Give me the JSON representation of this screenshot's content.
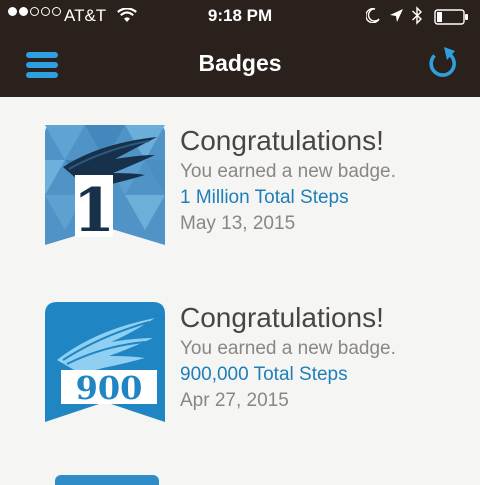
{
  "status_bar": {
    "carrier": "AT&T",
    "time": "9:18 PM",
    "signal_bars_filled": 2,
    "signal_bars_total": 5,
    "battery_level": 0.2
  },
  "nav": {
    "title": "Badges",
    "menu_icon": "hamburger-menu-icon",
    "refresh_icon": "refresh-icon"
  },
  "badges": [
    {
      "heading": "Congratulations!",
      "message": "You earned a new badge.",
      "badge_name": "1 Million Total Steps",
      "date": "May 13, 2015",
      "icon_number": "1"
    },
    {
      "heading": "Congratulations!",
      "message": "You earned a new badge.",
      "badge_name": "900,000 Total Steps",
      "date": "Apr 27, 2015",
      "icon_number": "900"
    }
  ],
  "colors": {
    "header_bg": "#2b211c",
    "accent_blue": "#2ea0e0",
    "link_blue": "#1e7fb8",
    "page_bg": "#f5f5f3"
  }
}
